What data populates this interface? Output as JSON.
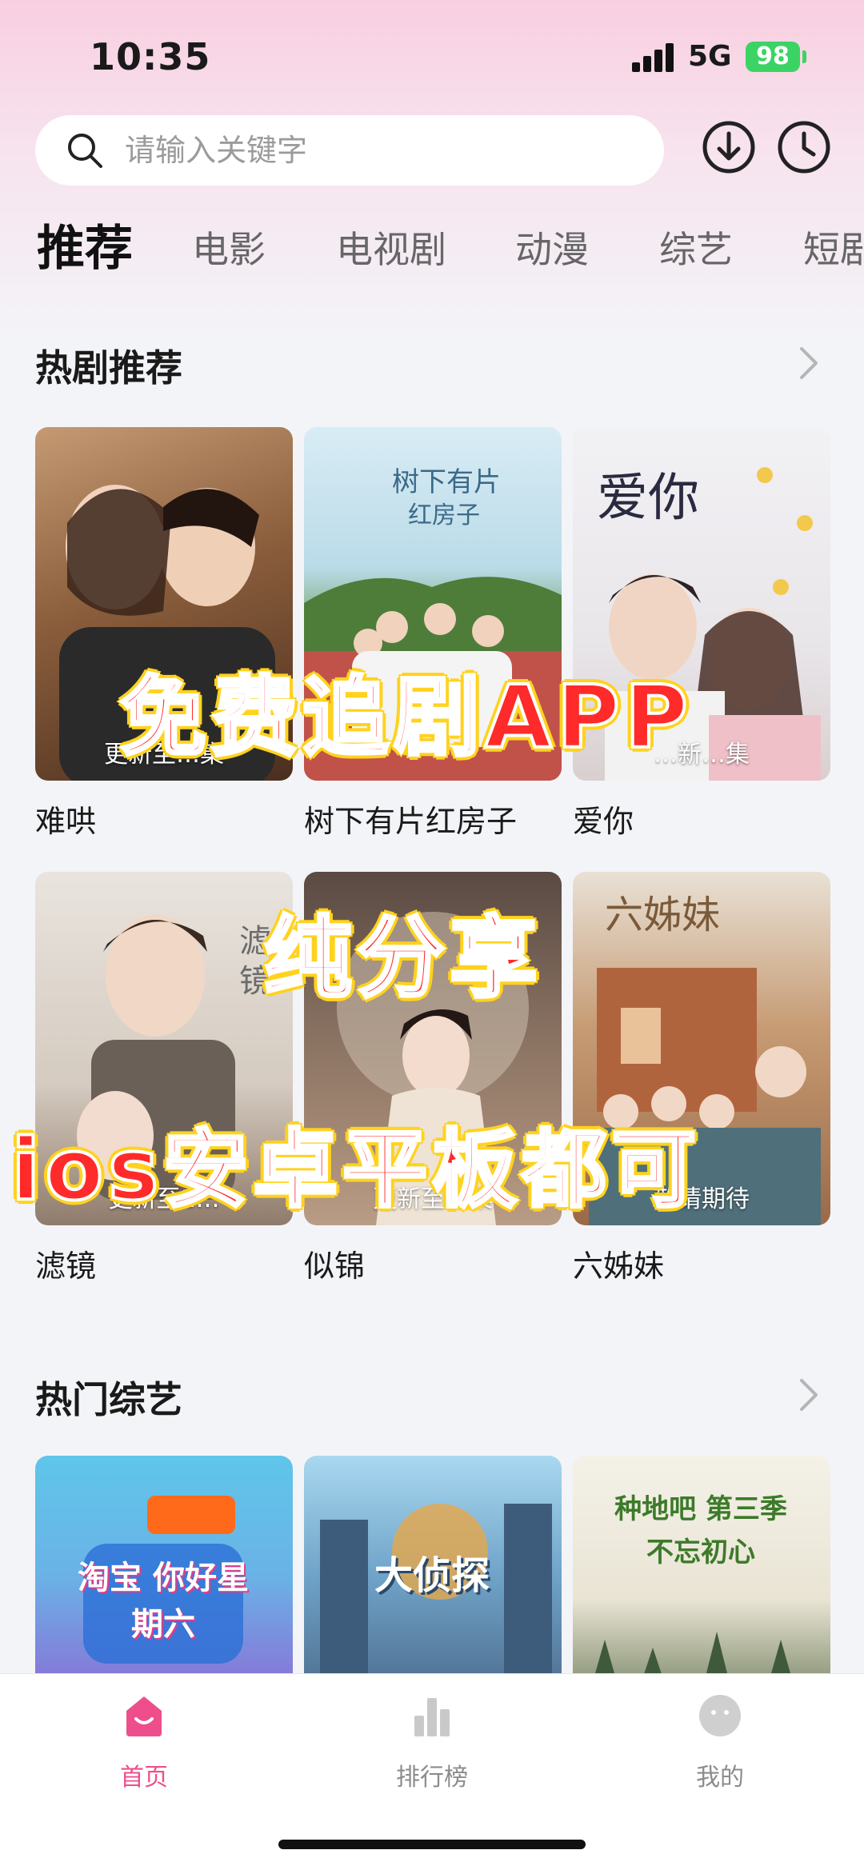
{
  "status_bar": {
    "time": "10:35",
    "network": "5G",
    "battery": "98"
  },
  "search": {
    "placeholder": "请输入关键字"
  },
  "header_icons": {
    "download": "download-icon",
    "history": "clock-icon"
  },
  "tabs": [
    {
      "label": "推荐",
      "active": true
    },
    {
      "label": "电影",
      "active": false
    },
    {
      "label": "电视剧",
      "active": false
    },
    {
      "label": "动漫",
      "active": false
    },
    {
      "label": "综艺",
      "active": false
    },
    {
      "label": "短剧",
      "active": false
    }
  ],
  "hot_dramas": {
    "title": "热剧推荐",
    "items": [
      {
        "title": "难哄",
        "caption": "更新至…集"
      },
      {
        "title": "树下有片红房子",
        "caption": ""
      },
      {
        "title": "爱你",
        "caption": "…新…集"
      },
      {
        "title": "滤镜",
        "caption": "更新至1…"
      },
      {
        "title": "似锦",
        "caption": "更新至…集"
      },
      {
        "title": "六姊妹",
        "caption": "敬请期待"
      }
    ]
  },
  "hot_variety": {
    "title": "热门综艺",
    "items": [
      {
        "poster_text": "淘宝 你好星期六"
      },
      {
        "poster_text": "大侦探"
      },
      {
        "poster_text": "种地吧 第三季 不忘初心"
      }
    ]
  },
  "overlay_text": {
    "line1": "免费追剧APP",
    "line2": "纯分享",
    "line3": "ios安卓平板都可"
  },
  "bottom_nav": [
    {
      "label": "首页",
      "icon": "home-icon",
      "active": true
    },
    {
      "label": "排行榜",
      "icon": "chart-icon",
      "active": false
    },
    {
      "label": "我的",
      "icon": "profile-icon",
      "active": false
    }
  ],
  "colors": {
    "accent": "#ee4f8c",
    "battery": "#3bd464",
    "overlay_red": "#ff2a2a",
    "overlay_yellow": "#ffd21e"
  }
}
